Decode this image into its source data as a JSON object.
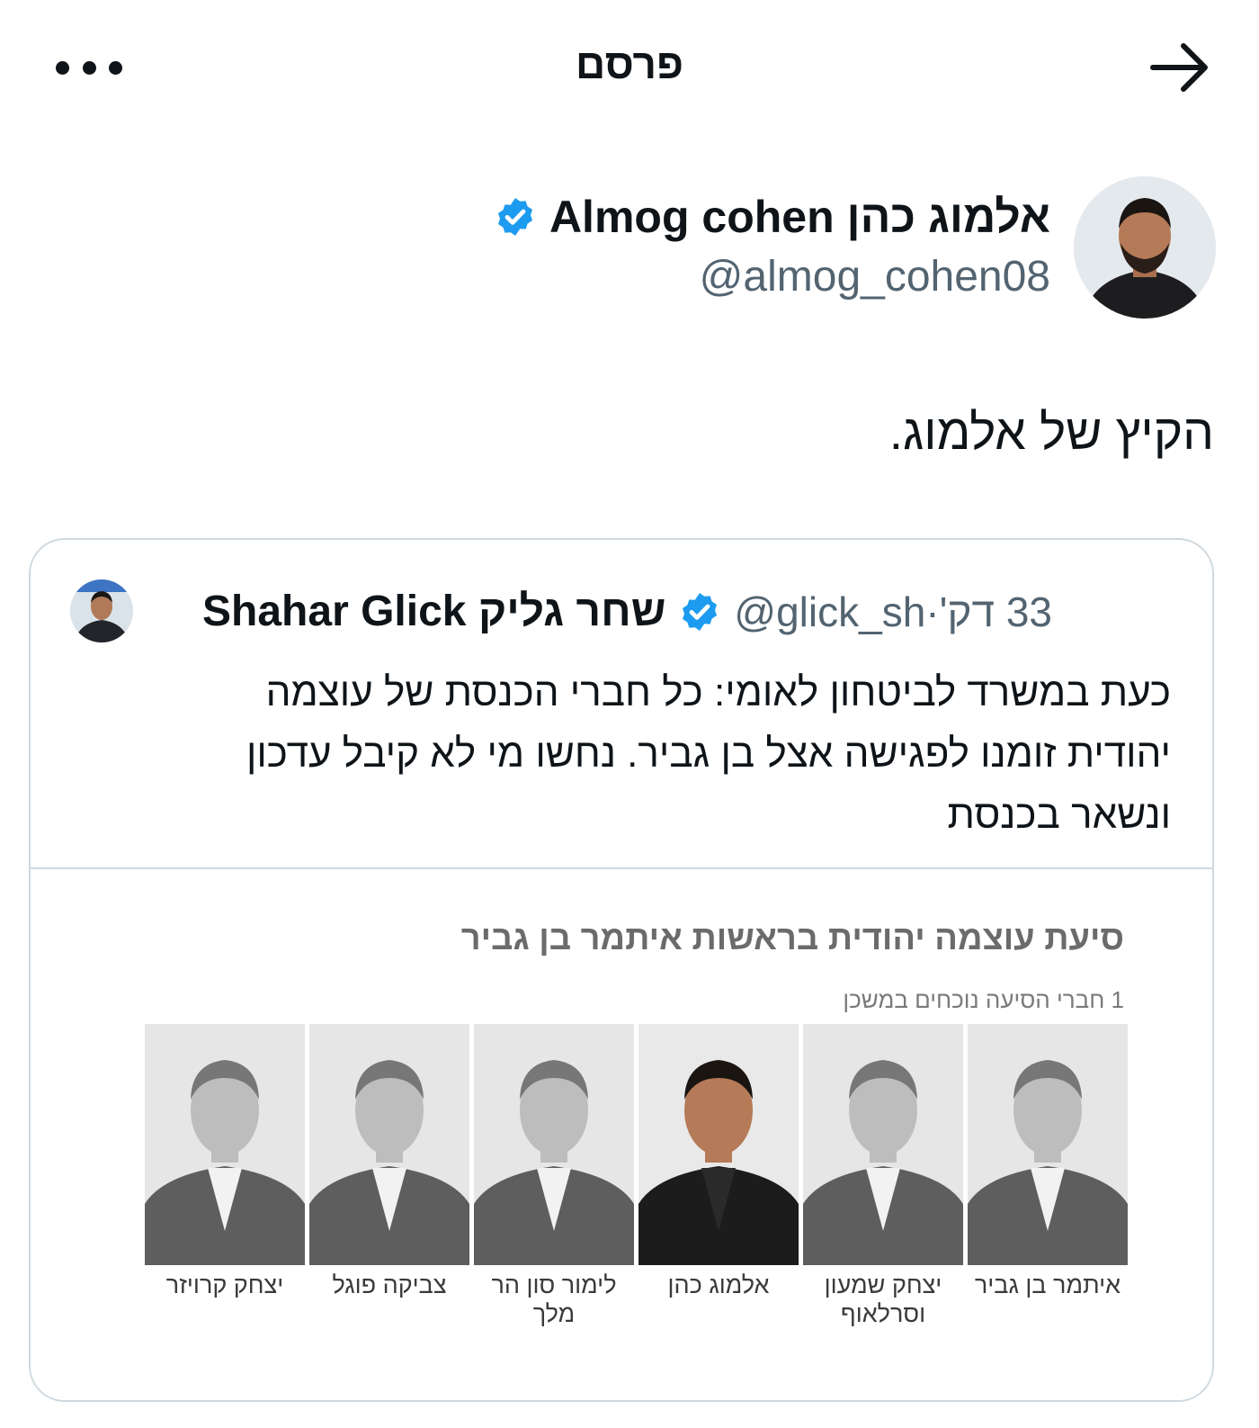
{
  "header": {
    "title": "פרסם",
    "more_icon": "more-horizontal-icon",
    "back_icon": "arrow-right-icon"
  },
  "author": {
    "display_name": "Almog cohen אלמוג כהן",
    "handle": "@almog_cohen08",
    "verified_color": "#1d9bf0"
  },
  "post": {
    "text": "הקיץ של אלמוג."
  },
  "quoted": {
    "display_name": "Shahar Glick שחר גליק",
    "handle": "@glick_sh",
    "separator": "·",
    "time": "33 דק'",
    "text_lines": [
      "כעת במשרד לביטחון לאומי: כל חברי הכנסת של עוצמה",
      "יהודית זומנו לפגישה אצל בן גביר. נחשו מי לא קיבל עדכון",
      "ונשאר בכנסת"
    ],
    "image": {
      "title": "סיעת עוצמה יהודית בראשות איתמר בן גביר",
      "subtitle": "1 חברי הסיעה נוכחים במשכן",
      "members": [
        {
          "name": "איתמר בן גביר",
          "highlight": false
        },
        {
          "name": "יצחק שמעון וסרלאוף",
          "highlight": false
        },
        {
          "name": "אלמוג כהן",
          "highlight": true
        },
        {
          "name": "לימור סון הר מלך",
          "highlight": false
        },
        {
          "name": "צביקה פוגל",
          "highlight": false
        },
        {
          "name": "יצחק קרויזר",
          "highlight": false
        }
      ]
    }
  }
}
